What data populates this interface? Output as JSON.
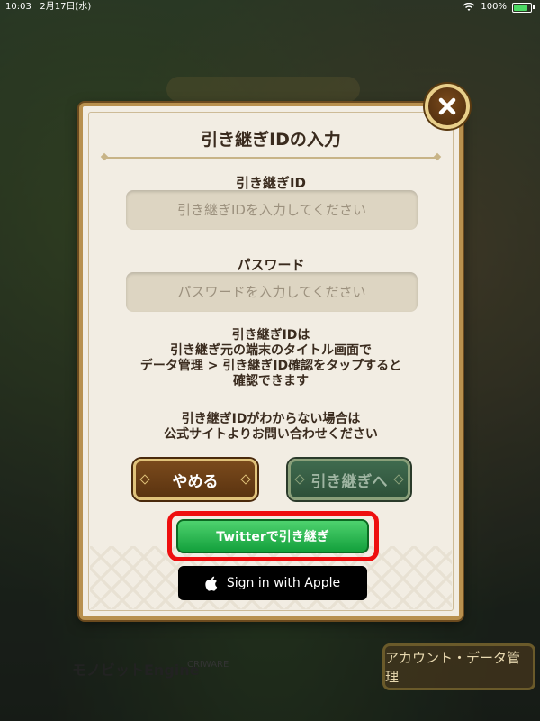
{
  "status_bar": {
    "time": "10:03",
    "date": "2月17日(水)",
    "battery": "100%"
  },
  "dialog": {
    "title": "引き継ぎIDの入力",
    "id_field": {
      "label": "引き継ぎID",
      "placeholder": "引き継ぎIDを入力してください",
      "value": ""
    },
    "password_field": {
      "label": "パスワード",
      "placeholder": "パスワードを入力してください",
      "value": ""
    },
    "info_lines": [
      "引き継ぎIDは",
      "引き継ぎ元の端末のタイトル画面で",
      "データ管理 > 引き継ぎID確認をタップすると",
      "確認できます"
    ],
    "help_lines": [
      "引き継ぎIDがわからない場合は",
      "公式サイトよりお問い合わせください"
    ],
    "cancel_label": "やめる",
    "next_label": "引き継ぎへ",
    "twitter_label": "Twitterで引き継ぎ",
    "apple_label": "Sign in with Apple"
  },
  "background": {
    "engine_logo": "モノビットEngine",
    "cri_logo": "CRIWARE",
    "account_button": "アカウント・データ管理"
  },
  "colors": {
    "dialog_bg": "#f2ede3",
    "dialog_border": "#b8904e",
    "cancel_btn": "#6a3c14",
    "next_btn": "#356048",
    "twitter_btn": "#22b14c",
    "highlight_border": "#ee0f0f",
    "apple_btn": "#000000"
  },
  "icons": [
    "close-icon",
    "apple-icon",
    "wifi-icon",
    "battery-icon"
  ]
}
